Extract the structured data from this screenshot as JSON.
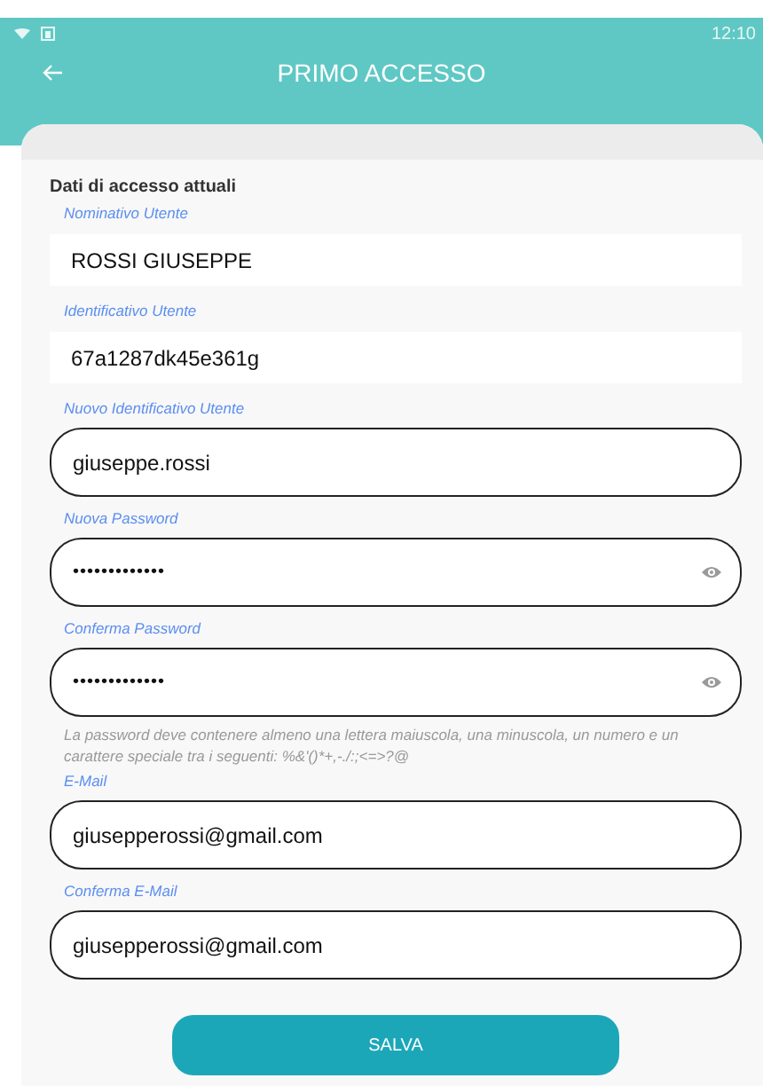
{
  "status_bar": {
    "time": "12:10"
  },
  "header": {
    "title": "PRIMO ACCESSO"
  },
  "section_title": "Dati di accesso attuali",
  "fields": [
    {
      "label": "Nominativo Utente",
      "kind": "readonly",
      "value": "ROSSI GIUSEPPE"
    },
    {
      "label": "Identificativo Utente",
      "kind": "readonly",
      "value": "67a1287dk45e361g"
    },
    {
      "label": "Nuovo Identificativo Utente",
      "kind": "text",
      "value": "giuseppe.rossi"
    },
    {
      "label": "Nuova Password",
      "kind": "password",
      "value": "•••••••••••••"
    },
    {
      "label": "Conferma Password",
      "kind": "password",
      "value": "•••••••••••••",
      "hint": "La password deve contenere almeno una lettera maiuscola, una minuscola, un numero e un carattere speciale tra i seguenti: %&'()*+,-./:;<=>?@"
    },
    {
      "label": "E-Mail",
      "kind": "text",
      "value": "giusepperossi@gmail.com"
    },
    {
      "label": "Conferma E-Mail",
      "kind": "text",
      "value": "giusepperossi@gmail.com"
    }
  ],
  "save_button": "SALVA"
}
